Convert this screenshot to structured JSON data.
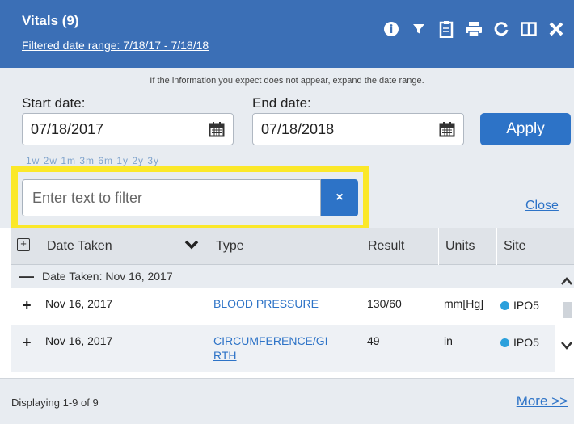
{
  "header": {
    "title": "Vitals (9)",
    "date_range_link": "Filtered date range: 7/18/17 - 7/18/18",
    "icons": [
      "info-icon",
      "filter-icon",
      "clipboard-icon",
      "print-icon",
      "refresh-icon",
      "columns-icon",
      "close-icon"
    ]
  },
  "filters": {
    "hint": "If the information you expect does not appear, expand the date range.",
    "start_label": "Start date:",
    "start_value": "07/18/2017",
    "end_label": "End date:",
    "end_value": "07/18/2018",
    "apply_label": "Apply",
    "shortcuts": "1w 2w 1m 3m 6m 1y 2y 3y"
  },
  "text_filter": {
    "placeholder": "Enter text to filter",
    "clear_label": "×",
    "close_link": "Close"
  },
  "table": {
    "columns": [
      "Date Taken",
      "Type",
      "Result",
      "Units",
      "Site"
    ],
    "group_label": "Date Taken:  Nov 16, 2017",
    "rows": [
      {
        "date": "Nov 16, 2017",
        "type": "BLOOD PRESSURE",
        "result": "130/60",
        "units": "mm[Hg]",
        "site": "IPO5"
      },
      {
        "date": "Nov 16, 2017",
        "type_line1": "CIRCUMFERENCE/GI",
        "type_line2": "RTH",
        "result": "49",
        "units": "in",
        "site": "IPO5"
      }
    ]
  },
  "footer": {
    "displaying": "Displaying 1-9 of 9",
    "more_link": "More >>"
  },
  "colors": {
    "header_bg": "#3b6fb6",
    "accent": "#2d73c7",
    "highlight": "#fbe829",
    "site_dot": "#2ba0dc"
  }
}
